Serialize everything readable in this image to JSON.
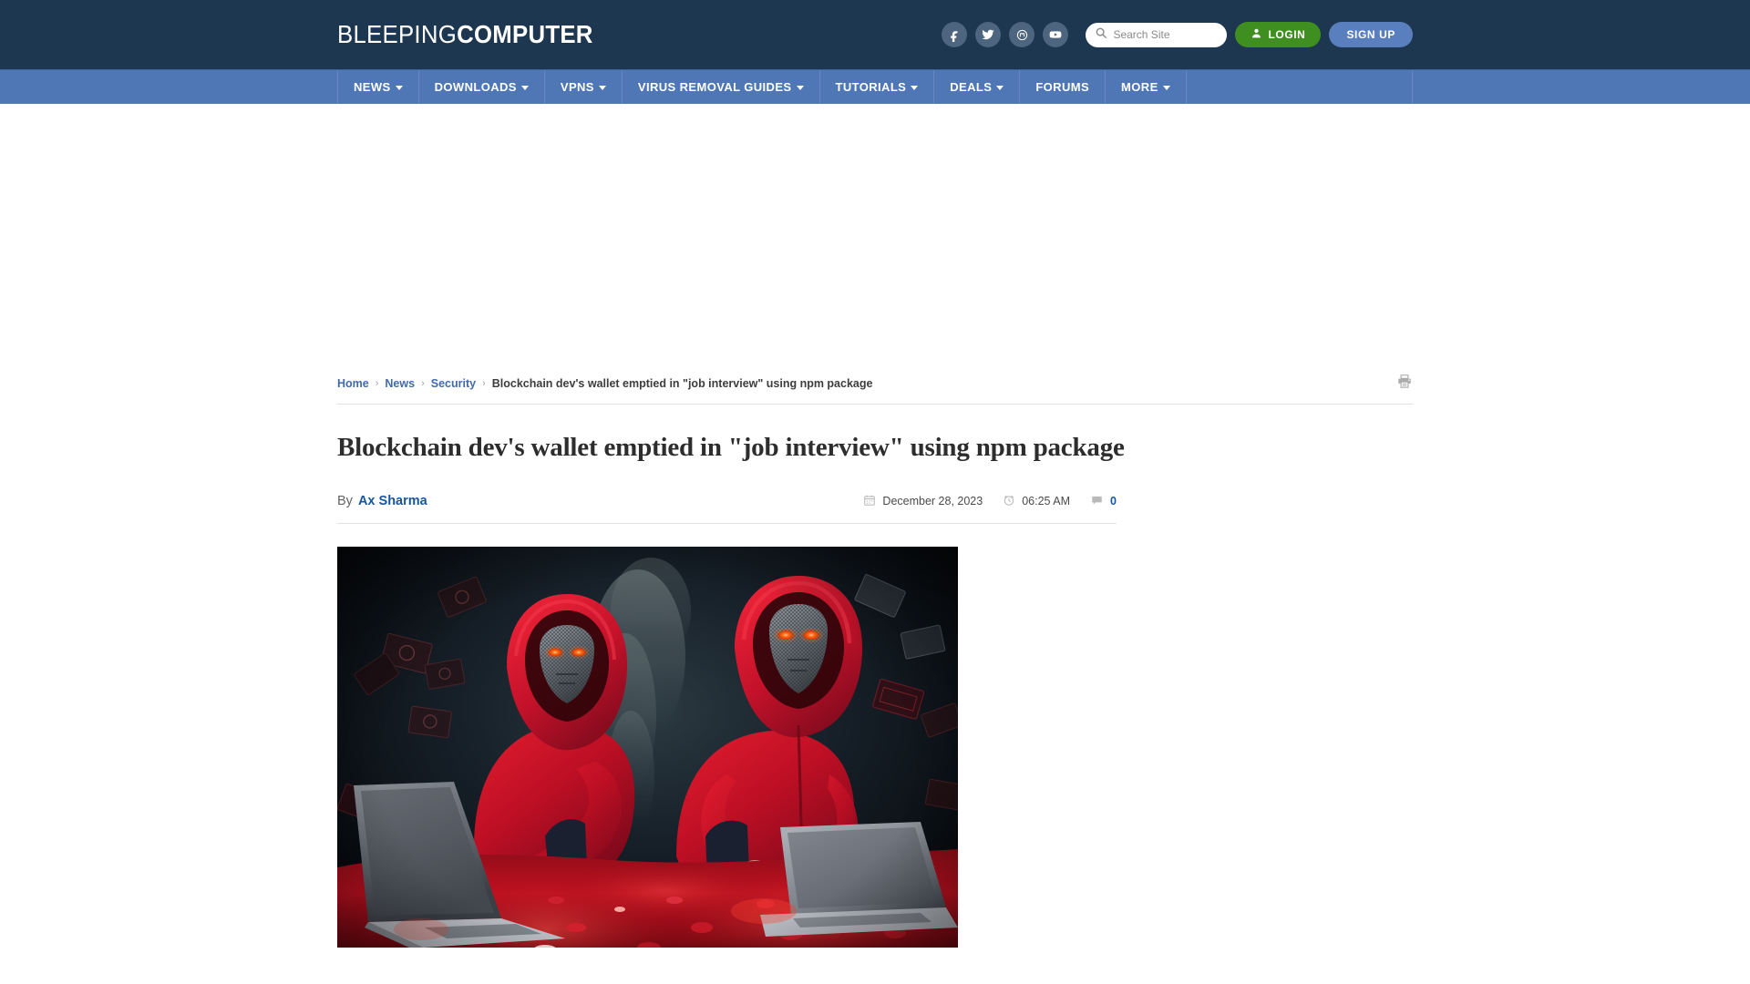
{
  "header": {
    "logo_light": "BLEEPING",
    "logo_bold": "COMPUTER",
    "social": [
      {
        "name": "facebook-icon",
        "label": "Facebook"
      },
      {
        "name": "twitter-icon",
        "label": "Twitter"
      },
      {
        "name": "mastodon-icon",
        "label": "Mastodon"
      },
      {
        "name": "youtube-icon",
        "label": "YouTube"
      }
    ],
    "search": {
      "placeholder": "Search Site",
      "value": "",
      "icon": "search-icon"
    },
    "login_label": "LOGIN",
    "signup_label": "SIGN UP",
    "colors": {
      "header_bg": "#1d3751",
      "nav_bg": "#4f77b5",
      "login_green": "#3f8f20",
      "signup_blue": "#5a7fbf",
      "link_blue": "#17569e"
    }
  },
  "nav": {
    "items": [
      {
        "label": "NEWS",
        "has_dropdown": true
      },
      {
        "label": "DOWNLOADS",
        "has_dropdown": true
      },
      {
        "label": "VPNS",
        "has_dropdown": true
      },
      {
        "label": "VIRUS REMOVAL GUIDES",
        "has_dropdown": true
      },
      {
        "label": "TUTORIALS",
        "has_dropdown": true
      },
      {
        "label": "DEALS",
        "has_dropdown": true
      },
      {
        "label": "FORUMS",
        "has_dropdown": false
      },
      {
        "label": "MORE",
        "has_dropdown": true
      }
    ]
  },
  "breadcrumb": {
    "items": [
      {
        "label": "Home",
        "current": false
      },
      {
        "label": "News",
        "current": false
      },
      {
        "label": "Security",
        "current": false
      },
      {
        "label": "Blockchain dev's wallet emptied in \"job interview\" using npm package",
        "current": true
      }
    ],
    "separator": "›",
    "print_icon": "printer-icon"
  },
  "article": {
    "title": "Blockchain dev's wallet emptied in \"job interview\" using npm package",
    "by_prefix": "By",
    "author": "Ax Sharma",
    "date": "December 28, 2023",
    "date_icon": "calendar-icon",
    "time": "06:25 AM",
    "time_icon": "clock-icon",
    "comment_count": "0",
    "comment_icon": "comment-icon",
    "hero_alt": "Two masked hooded figures in red hoodies typing on laptops over a pile of glowing red crypto coins"
  }
}
